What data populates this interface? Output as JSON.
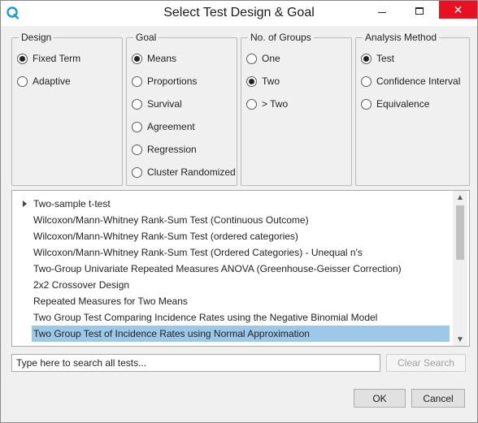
{
  "window": {
    "title": "Select Test Design & Goal",
    "controls": {
      "minimize": "─",
      "maximize": "☐",
      "close": "✕"
    }
  },
  "groups": {
    "design": {
      "title": "Design",
      "options": [
        {
          "label": "Fixed Term",
          "checked": true
        },
        {
          "label": "Adaptive",
          "checked": false
        }
      ]
    },
    "goal": {
      "title": "Goal",
      "options": [
        {
          "label": "Means",
          "checked": true
        },
        {
          "label": "Proportions",
          "checked": false
        },
        {
          "label": "Survival",
          "checked": false
        },
        {
          "label": "Agreement",
          "checked": false
        },
        {
          "label": "Regression",
          "checked": false
        },
        {
          "label": "Cluster Randomized",
          "checked": false
        }
      ]
    },
    "groups_count": {
      "title": "No. of Groups",
      "options": [
        {
          "label": "One",
          "checked": false
        },
        {
          "label": "Two",
          "checked": true
        },
        {
          "label": "> Two",
          "checked": false
        }
      ]
    },
    "analysis": {
      "title": "Analysis Method",
      "options": [
        {
          "label": "Test",
          "checked": true
        },
        {
          "label": "Confidence Interval",
          "checked": false
        },
        {
          "label": "Equivalence",
          "checked": false
        }
      ]
    }
  },
  "tests": {
    "items": [
      {
        "label": "Two-sample t-test",
        "expandable": true,
        "selected": false
      },
      {
        "label": "Wilcoxon/Mann-Whitney Rank-Sum Test (Continuous Outcome)",
        "selected": false
      },
      {
        "label": "Wilcoxon/Mann-Whitney Rank-Sum Test (ordered categories)",
        "selected": false
      },
      {
        "label": "Wilcoxon/Mann-Whitney Rank-Sum Test (Ordered Categories) - Unequal n's",
        "selected": false
      },
      {
        "label": "Two-Group Univariate Repeated Measures ANOVA (Greenhouse-Geisser Correction)",
        "selected": false
      },
      {
        "label": "2x2 Crossover Design",
        "selected": false
      },
      {
        "label": "Repeated Measures for Two Means",
        "selected": false
      },
      {
        "label": "Two Group Test Comparing Incidence Rates using the Negative Binomial Model",
        "selected": false
      },
      {
        "label": "Two Group Test of Incidence Rates using Normal Approximation",
        "selected": true
      }
    ]
  },
  "search": {
    "placeholder": "Type here to search all tests...",
    "value": "",
    "clear_label": "Clear Search"
  },
  "buttons": {
    "ok": "OK",
    "cancel": "Cancel"
  },
  "colors": {
    "selection": "#9dc8e8",
    "close_button": "#e81123",
    "accent_icon": "#1e9bd7"
  }
}
